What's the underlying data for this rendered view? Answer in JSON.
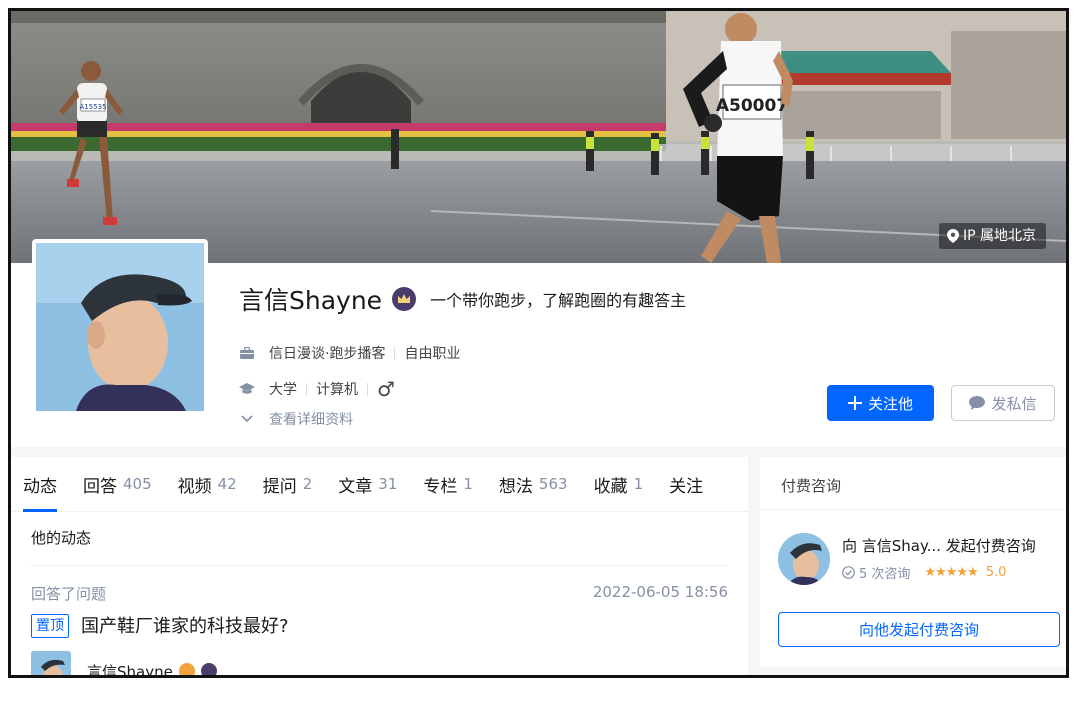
{
  "profile": {
    "name": "言信Shayne",
    "bio": "一个带你跑步，了解跑圈的有趣答主",
    "ip": "IP 属地北京",
    "work": {
      "company": "信日漫谈·跑步播客",
      "job": "自由职业"
    },
    "edu": {
      "school": "大学",
      "major": "计算机"
    },
    "gender": "♂",
    "more": "查看详细资料",
    "bib_front": "A50007",
    "bib_back": "A15535"
  },
  "actions": {
    "follow": "关注他",
    "message": "发私信"
  },
  "tabs": [
    {
      "label": "动态",
      "count": ""
    },
    {
      "label": "回答",
      "count": "405"
    },
    {
      "label": "视频",
      "count": "42"
    },
    {
      "label": "提问",
      "count": "2"
    },
    {
      "label": "文章",
      "count": "31"
    },
    {
      "label": "专栏",
      "count": "1"
    },
    {
      "label": "想法",
      "count": "563"
    },
    {
      "label": "收藏",
      "count": "1"
    },
    {
      "label": "关注",
      "count": ""
    }
  ],
  "feed": {
    "title": "他的动态",
    "activity": {
      "label": "回答了问题",
      "time": "2022-06-05 18:56",
      "pin": "置顶",
      "question": "国产鞋厂谁家的科技最好?",
      "author": "言信Shayne"
    }
  },
  "consult": {
    "title": "付费咨询",
    "line": "向 言信Shay... 发起付费咨询",
    "count_text": "5 次咨询",
    "stars": "★★★★★",
    "rating": "5.0",
    "button": "向他发起付费咨询"
  },
  "colors": {
    "primary": "#0066ff",
    "muted": "#8590a6",
    "star": "#f1a23b"
  }
}
